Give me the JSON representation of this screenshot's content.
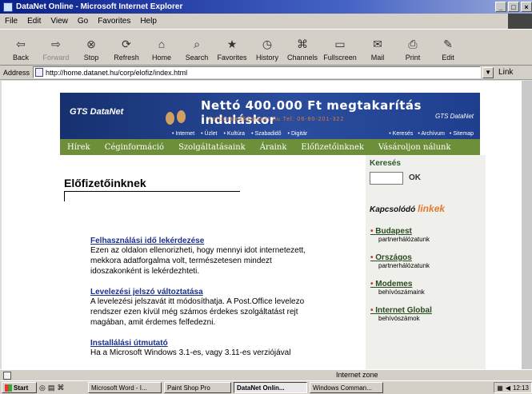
{
  "window": {
    "title": "DataNet Online - Microsoft Internet Explorer",
    "controls": [
      "_",
      "□",
      "×"
    ]
  },
  "menubar": {
    "items": [
      "File",
      "Edit",
      "View",
      "Go",
      "Favorites",
      "Help"
    ]
  },
  "toolbar": {
    "back": "Back",
    "forward": "Forward",
    "stop": "Stop",
    "refresh": "Refresh",
    "home": "Home",
    "search": "Search",
    "favorites": "Favorites",
    "history": "History",
    "channels": "Channels",
    "fullscreen": "Fullscreen",
    "mail": "Mail",
    "print": "Print",
    "edit": "Edit"
  },
  "address": {
    "label": "Address",
    "url": "http://home.datanet.hu/corp/elofiz/index.html",
    "links": "Link"
  },
  "banner": {
    "logo": "GTS DataNet",
    "headline": "Nettó 400.000 Ft megtakarítás induláskor",
    "contact": "corporate@datanet.hu   Tel: 06-80-201-322",
    "logo_right": "GTS DataNet",
    "subnav": [
      "• Internet",
      "• Üzlet",
      "• Kultúra",
      "• Szabadidő",
      "• Digitár"
    ],
    "subnav_right": [
      "• Keresés",
      "• Archívum",
      "• Sitemap"
    ]
  },
  "mainnav": [
    "Hírek",
    "Céginformáció",
    "Szolgáltatásaink",
    "Áraink",
    "Előfizetőinknek",
    "Vásároljon nálunk"
  ],
  "content": {
    "title": "Előfizetőinknek",
    "entries": [
      {
        "link": "Felhasználási idő lekérdezése",
        "desc": "Ezen az oldalon ellenorizheti, hogy mennyi idot internetezett, mekkora adatforgalma volt, természetesen mindezt idoszakonként is lekérdezhteti."
      },
      {
        "link": "Levelezési jelszó változtatása",
        "desc": "A levelezési jelszavát itt módosíthatja. A Post.Office levelezo rendszer ezen kívül még számos érdekes szolgáltatást rejt magában, amit érdemes felfedezni."
      },
      {
        "link": "Installálási útmutató",
        "desc": "Ha a Microsoft Windows 3.1-es, vagy 3.11-es verziójával"
      }
    ]
  },
  "sidebar": {
    "search_title": "Keresés",
    "ok": "OK",
    "related_prefix": "Kapcsolódó",
    "related_suffix": "linkek",
    "items": [
      {
        "title": "Budapest",
        "sub": "partnerhálózatunk"
      },
      {
        "title": "Országos",
        "sub": "partnerhálózatunk"
      },
      {
        "title": "Modemes",
        "sub": "behívószámaink"
      },
      {
        "title": "Internet Global",
        "sub": "behívószámok"
      }
    ]
  },
  "statusbar": {
    "zone": "Internet zone"
  },
  "taskbar": {
    "start": "Start",
    "tasks": [
      "Microsoft Word - I...",
      "Paint Shop Pro",
      "DataNet Onlin...",
      "Windows Comman..."
    ],
    "time": "12:13"
  }
}
